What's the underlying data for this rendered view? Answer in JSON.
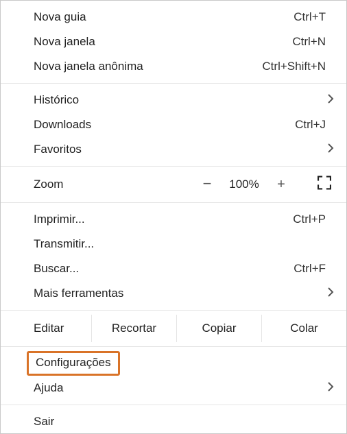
{
  "menu": {
    "new_tab": {
      "label": "Nova guia",
      "shortcut": "Ctrl+T"
    },
    "new_window": {
      "label": "Nova janela",
      "shortcut": "Ctrl+N"
    },
    "incognito": {
      "label": "Nova janela anônima",
      "shortcut": "Ctrl+Shift+N"
    },
    "history": {
      "label": "Histórico"
    },
    "downloads": {
      "label": "Downloads",
      "shortcut": "Ctrl+J"
    },
    "bookmarks": {
      "label": "Favoritos"
    },
    "zoom": {
      "label": "Zoom",
      "level": "100%",
      "minus": "−",
      "plus": "+"
    },
    "print": {
      "label": "Imprimir...",
      "shortcut": "Ctrl+P"
    },
    "cast": {
      "label": "Transmitir..."
    },
    "find": {
      "label": "Buscar...",
      "shortcut": "Ctrl+F"
    },
    "more_tools": {
      "label": "Mais ferramentas"
    },
    "edit": {
      "label": "Editar",
      "cut": "Recortar",
      "copy": "Copiar",
      "paste": "Colar"
    },
    "settings": {
      "label": "Configurações"
    },
    "help": {
      "label": "Ajuda"
    },
    "exit": {
      "label": "Sair"
    }
  }
}
